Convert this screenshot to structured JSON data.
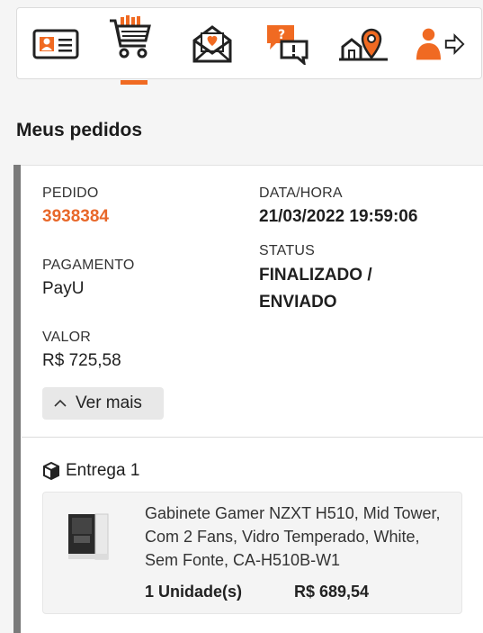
{
  "nav": {
    "icons": [
      "id-card-icon",
      "shopping-cart-icon",
      "envelope-heart-icon",
      "chat-question-icon",
      "house-location-icon",
      "user-logout-icon"
    ],
    "active_index": 1,
    "accent_color": "#f06a22"
  },
  "page": {
    "title": "Meus pedidos"
  },
  "order": {
    "pedido_label": "PEDIDO",
    "pedido_value": "3938384",
    "datahora_label": "DATA/HORA",
    "datahora_value": "21/03/2022 19:59:06",
    "status_label": "STATUS",
    "status_line1": "FINALIZADO /",
    "status_line2": "ENVIADO",
    "pagamento_label": "PAGAMENTO",
    "pagamento_value": "PayU",
    "valor_label": "VALOR",
    "valor_value": "R$ 725,58",
    "ver_mais": "Ver mais"
  },
  "delivery": {
    "title": "Entrega 1",
    "product_name": "Gabinete Gamer NZXT H510, Mid Tower, Com 2 Fans, Vidro Temperado, White, Sem Fonte, CA-H510B-W1",
    "quantity": "1 Unidade(s)",
    "price": "R$ 689,54"
  }
}
